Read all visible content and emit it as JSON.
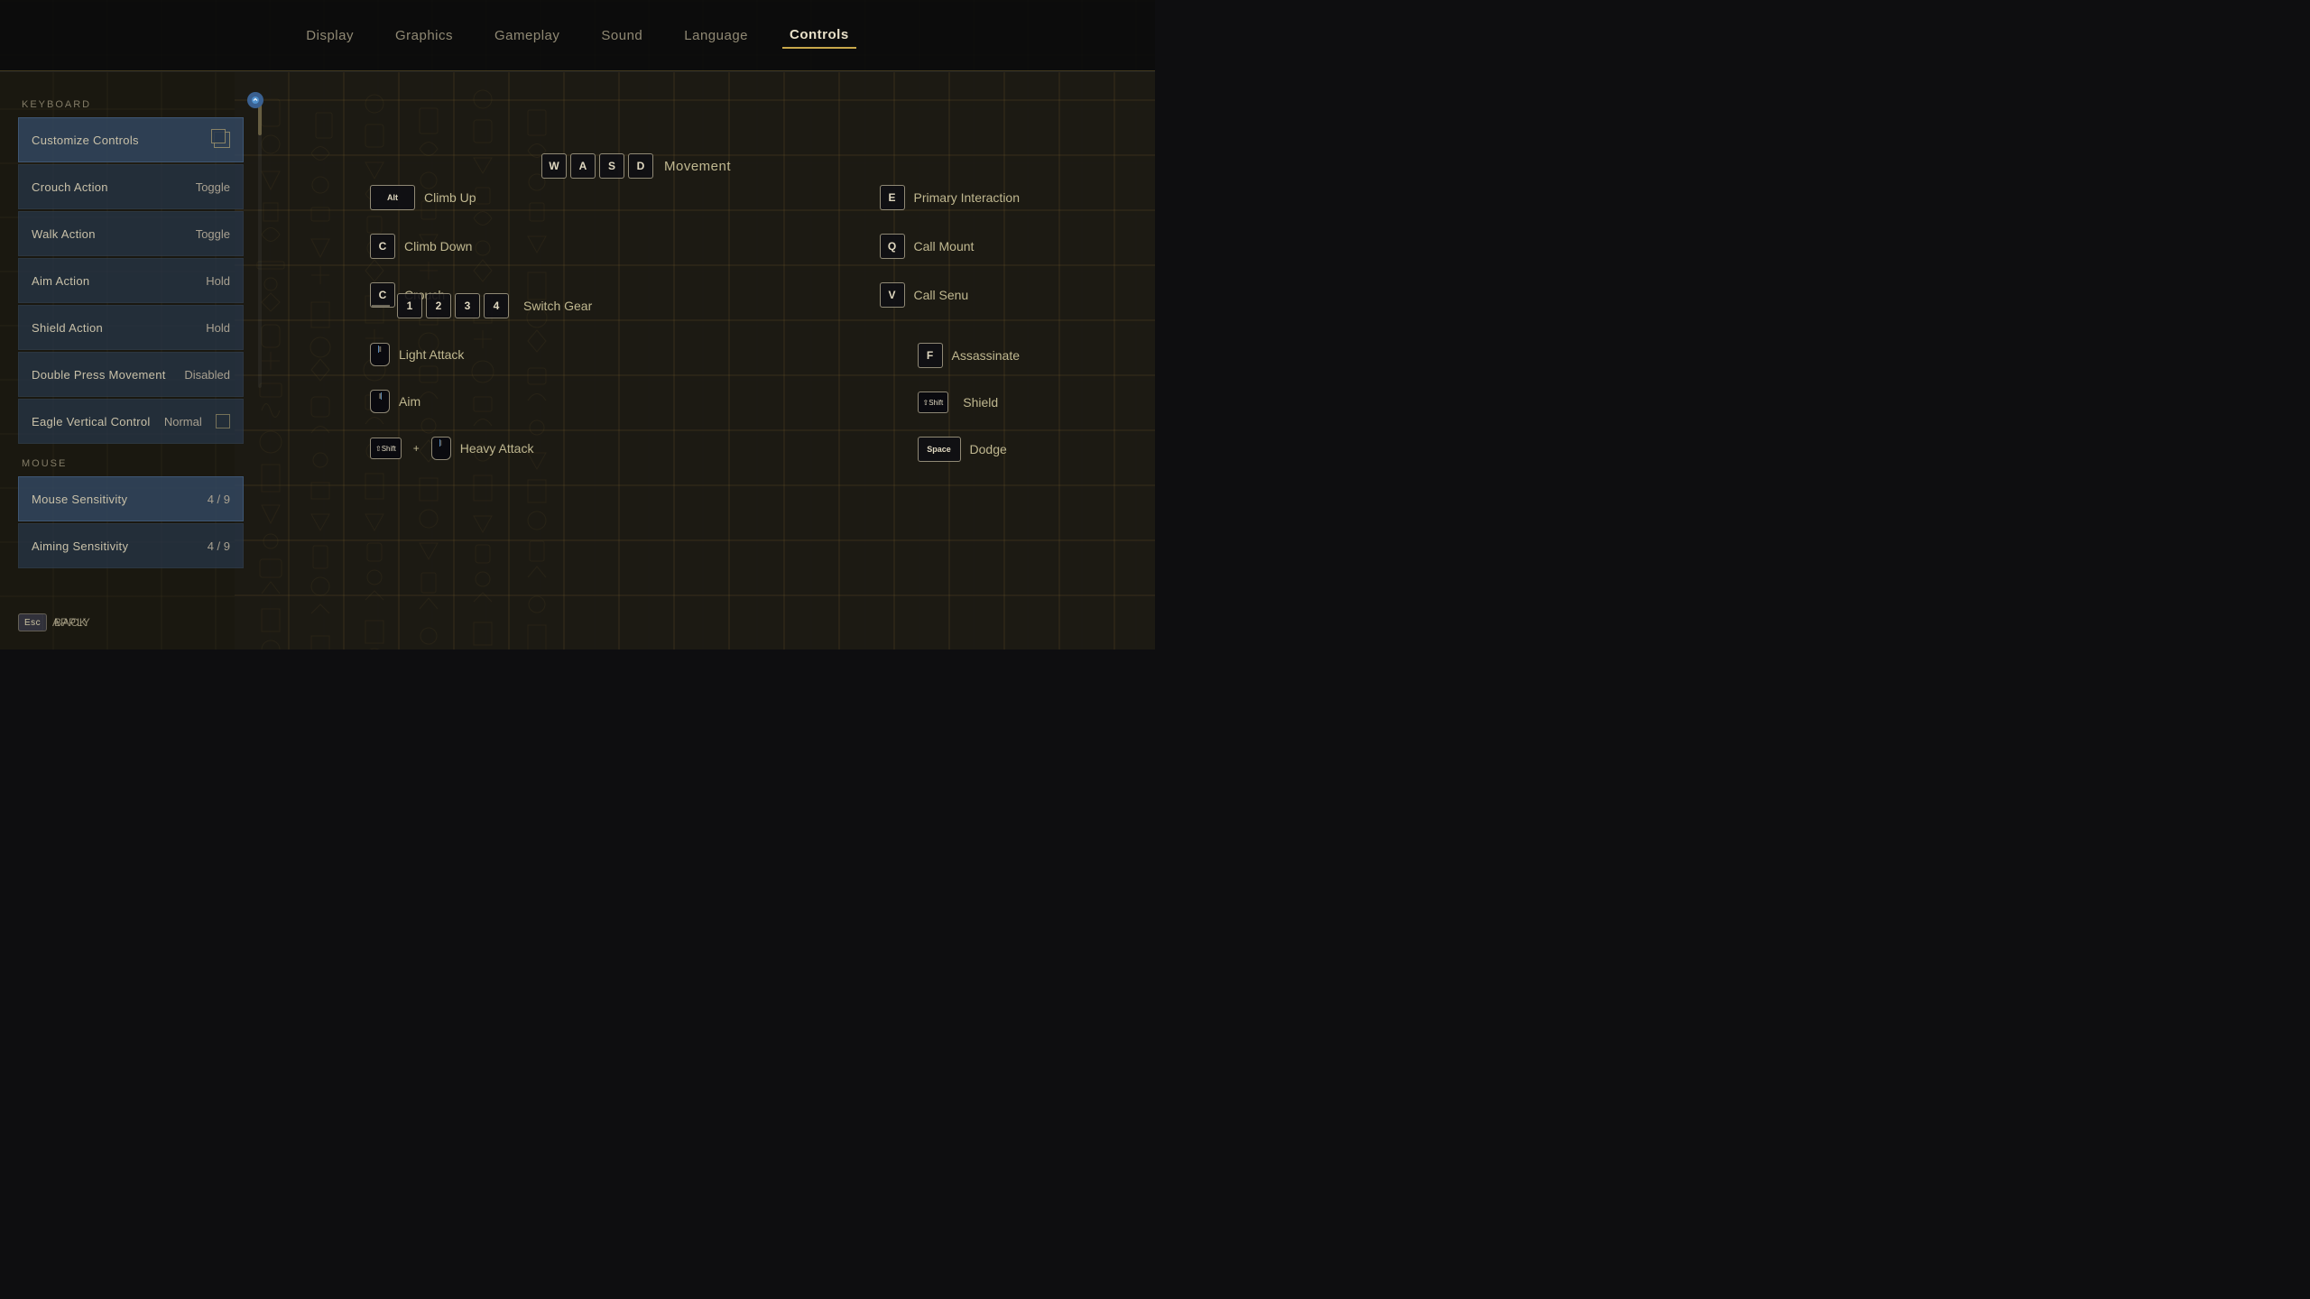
{
  "nav": {
    "items": [
      {
        "id": "display",
        "label": "Display",
        "active": false
      },
      {
        "id": "graphics",
        "label": "Graphics",
        "active": false
      },
      {
        "id": "gameplay",
        "label": "Gameplay",
        "active": false
      },
      {
        "id": "sound",
        "label": "Sound",
        "active": false
      },
      {
        "id": "language",
        "label": "Language",
        "active": false
      },
      {
        "id": "controls",
        "label": "Controls",
        "active": true
      }
    ]
  },
  "sidebar": {
    "keyboard_label": "KEYBOARD",
    "mouse_label": "MOUSE",
    "items": [
      {
        "label": "Customize Controls",
        "value": "",
        "has_icon": true
      },
      {
        "label": "Crouch Action",
        "value": "Toggle"
      },
      {
        "label": "Walk Action",
        "value": "Toggle"
      },
      {
        "label": "Aim Action",
        "value": "Hold"
      },
      {
        "label": "Shield Action",
        "value": "Hold"
      },
      {
        "label": "Double Press Movement",
        "value": "Disabled"
      },
      {
        "label": "Eagle Vertical Control",
        "value": "Normal",
        "has_checkbox": true
      }
    ],
    "mouse_items": [
      {
        "label": "Mouse Sensitivity",
        "value": "4 / 9"
      },
      {
        "label": "Aiming Sensitivity",
        "value": "4 / 9"
      }
    ]
  },
  "bottom": {
    "apply_key": "↵",
    "apply_label": "APPLY",
    "back_key": "Esc",
    "back_label": "BACK"
  },
  "diagram": {
    "movement_label": "Movement",
    "wasd": [
      "W",
      "A",
      "S",
      "D"
    ],
    "left_column": [
      {
        "key": "Alt",
        "key_type": "wide",
        "action": "Climb Up"
      },
      {
        "key": "C",
        "action": "Climb Down"
      },
      {
        "key": "C",
        "action": "Crouch"
      }
    ],
    "right_column": [
      {
        "key": "E",
        "action": "Primary Interaction"
      },
      {
        "key": "Q",
        "action": "Call Mount"
      },
      {
        "key": "V",
        "action": "Call Senu"
      }
    ],
    "gear": {
      "label": "Switch Gear",
      "numbers": [
        "1",
        "2",
        "3",
        "4"
      ]
    },
    "combat_left": [
      {
        "key": "LMB",
        "key_type": "mouse_left",
        "action": "Light Attack"
      },
      {
        "key": "RMB",
        "key_type": "mouse_right",
        "action": "Aim"
      },
      {
        "key": "SHIFT+LMB",
        "key_type": "combo",
        "action": "Heavy Attack"
      }
    ],
    "combat_right": [
      {
        "key": "F",
        "action": "Assassinate"
      },
      {
        "key": "⇧Shift",
        "key_type": "wide",
        "action": "Shield"
      },
      {
        "key": "Space",
        "key_type": "wide",
        "action": "Dodge"
      }
    ]
  }
}
